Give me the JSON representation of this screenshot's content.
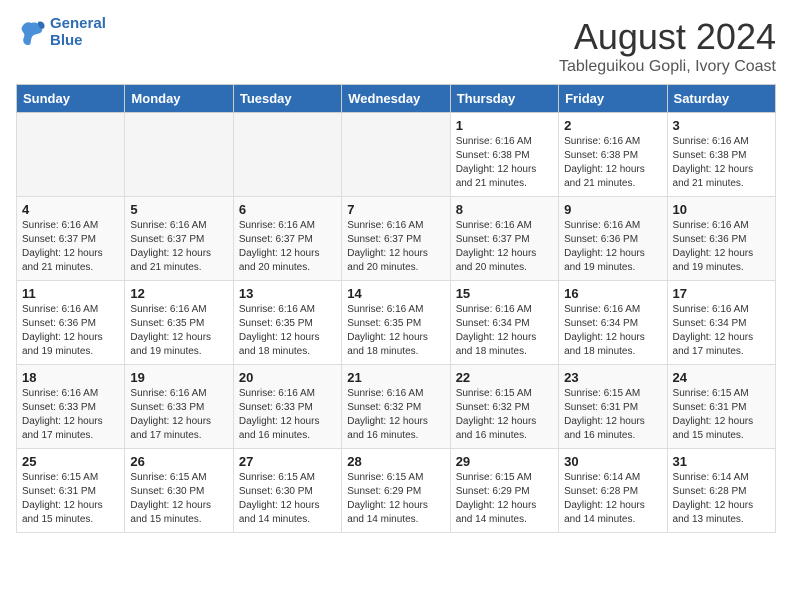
{
  "header": {
    "logo_line1": "General",
    "logo_line2": "Blue",
    "title": "August 2024",
    "subtitle": "Tableguikou Gopli, Ivory Coast"
  },
  "weekdays": [
    "Sunday",
    "Monday",
    "Tuesday",
    "Wednesday",
    "Thursday",
    "Friday",
    "Saturday"
  ],
  "weeks": [
    [
      {
        "day": "",
        "info": ""
      },
      {
        "day": "",
        "info": ""
      },
      {
        "day": "",
        "info": ""
      },
      {
        "day": "",
        "info": ""
      },
      {
        "day": "1",
        "info": "Sunrise: 6:16 AM\nSunset: 6:38 PM\nDaylight: 12 hours\nand 21 minutes."
      },
      {
        "day": "2",
        "info": "Sunrise: 6:16 AM\nSunset: 6:38 PM\nDaylight: 12 hours\nand 21 minutes."
      },
      {
        "day": "3",
        "info": "Sunrise: 6:16 AM\nSunset: 6:38 PM\nDaylight: 12 hours\nand 21 minutes."
      }
    ],
    [
      {
        "day": "4",
        "info": "Sunrise: 6:16 AM\nSunset: 6:37 PM\nDaylight: 12 hours\nand 21 minutes."
      },
      {
        "day": "5",
        "info": "Sunrise: 6:16 AM\nSunset: 6:37 PM\nDaylight: 12 hours\nand 21 minutes."
      },
      {
        "day": "6",
        "info": "Sunrise: 6:16 AM\nSunset: 6:37 PM\nDaylight: 12 hours\nand 20 minutes."
      },
      {
        "day": "7",
        "info": "Sunrise: 6:16 AM\nSunset: 6:37 PM\nDaylight: 12 hours\nand 20 minutes."
      },
      {
        "day": "8",
        "info": "Sunrise: 6:16 AM\nSunset: 6:37 PM\nDaylight: 12 hours\nand 20 minutes."
      },
      {
        "day": "9",
        "info": "Sunrise: 6:16 AM\nSunset: 6:36 PM\nDaylight: 12 hours\nand 19 minutes."
      },
      {
        "day": "10",
        "info": "Sunrise: 6:16 AM\nSunset: 6:36 PM\nDaylight: 12 hours\nand 19 minutes."
      }
    ],
    [
      {
        "day": "11",
        "info": "Sunrise: 6:16 AM\nSunset: 6:36 PM\nDaylight: 12 hours\nand 19 minutes."
      },
      {
        "day": "12",
        "info": "Sunrise: 6:16 AM\nSunset: 6:35 PM\nDaylight: 12 hours\nand 19 minutes."
      },
      {
        "day": "13",
        "info": "Sunrise: 6:16 AM\nSunset: 6:35 PM\nDaylight: 12 hours\nand 18 minutes."
      },
      {
        "day": "14",
        "info": "Sunrise: 6:16 AM\nSunset: 6:35 PM\nDaylight: 12 hours\nand 18 minutes."
      },
      {
        "day": "15",
        "info": "Sunrise: 6:16 AM\nSunset: 6:34 PM\nDaylight: 12 hours\nand 18 minutes."
      },
      {
        "day": "16",
        "info": "Sunrise: 6:16 AM\nSunset: 6:34 PM\nDaylight: 12 hours\nand 18 minutes."
      },
      {
        "day": "17",
        "info": "Sunrise: 6:16 AM\nSunset: 6:34 PM\nDaylight: 12 hours\nand 17 minutes."
      }
    ],
    [
      {
        "day": "18",
        "info": "Sunrise: 6:16 AM\nSunset: 6:33 PM\nDaylight: 12 hours\nand 17 minutes."
      },
      {
        "day": "19",
        "info": "Sunrise: 6:16 AM\nSunset: 6:33 PM\nDaylight: 12 hours\nand 17 minutes."
      },
      {
        "day": "20",
        "info": "Sunrise: 6:16 AM\nSunset: 6:33 PM\nDaylight: 12 hours\nand 16 minutes."
      },
      {
        "day": "21",
        "info": "Sunrise: 6:16 AM\nSunset: 6:32 PM\nDaylight: 12 hours\nand 16 minutes."
      },
      {
        "day": "22",
        "info": "Sunrise: 6:15 AM\nSunset: 6:32 PM\nDaylight: 12 hours\nand 16 minutes."
      },
      {
        "day": "23",
        "info": "Sunrise: 6:15 AM\nSunset: 6:31 PM\nDaylight: 12 hours\nand 16 minutes."
      },
      {
        "day": "24",
        "info": "Sunrise: 6:15 AM\nSunset: 6:31 PM\nDaylight: 12 hours\nand 15 minutes."
      }
    ],
    [
      {
        "day": "25",
        "info": "Sunrise: 6:15 AM\nSunset: 6:31 PM\nDaylight: 12 hours\nand 15 minutes."
      },
      {
        "day": "26",
        "info": "Sunrise: 6:15 AM\nSunset: 6:30 PM\nDaylight: 12 hours\nand 15 minutes."
      },
      {
        "day": "27",
        "info": "Sunrise: 6:15 AM\nSunset: 6:30 PM\nDaylight: 12 hours\nand 14 minutes."
      },
      {
        "day": "28",
        "info": "Sunrise: 6:15 AM\nSunset: 6:29 PM\nDaylight: 12 hours\nand 14 minutes."
      },
      {
        "day": "29",
        "info": "Sunrise: 6:15 AM\nSunset: 6:29 PM\nDaylight: 12 hours\nand 14 minutes."
      },
      {
        "day": "30",
        "info": "Sunrise: 6:14 AM\nSunset: 6:28 PM\nDaylight: 12 hours\nand 14 minutes."
      },
      {
        "day": "31",
        "info": "Sunrise: 6:14 AM\nSunset: 6:28 PM\nDaylight: 12 hours\nand 13 minutes."
      }
    ]
  ]
}
